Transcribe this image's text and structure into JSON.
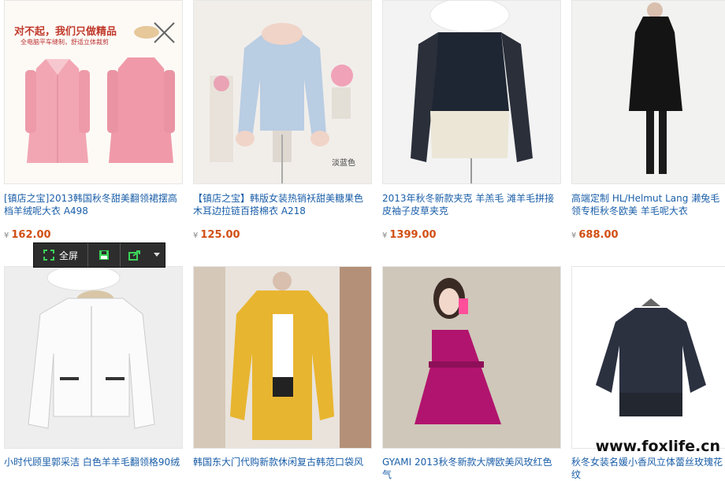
{
  "products": [
    {
      "title": "[镇店之宝]2013韩国秋冬甜美翻领裙摆高档羊绒呢大衣 A498",
      "price": "162.00",
      "currency": "¥",
      "ad_headline": "对不起，我们只做精品",
      "ad_subline": "全电脑平车缝制，舒适立体裁剪"
    },
    {
      "title": "【镇店之宝】韩版女装热销袄甜美糖果色木耳边拉链百搭棉衣 A218",
      "price": "125.00",
      "currency": "¥",
      "color_tag": "淡蓝色"
    },
    {
      "title": "2013年秋冬新款夹克 羊羔毛 滩羊毛拼接皮袖子皮草夹克",
      "price": "1399.00",
      "currency": "¥"
    },
    {
      "title": "高端定制 HL/Helmut Lang 濑兔毛领专柜秋冬欧美 羊毛呢大衣",
      "price": "688.00",
      "currency": "¥"
    },
    {
      "title": "小时代顾里郭采洁 白色羊羊毛翻领格90绒"
    },
    {
      "title": "韩国东大门代购新款休闲复古韩范口袋风"
    },
    {
      "title": "GYAMI 2013秋冬新款大牌欧美风玫红色气"
    },
    {
      "title": "秋冬女装名媛小香风立体蕾丝玫瑰花纹"
    }
  ],
  "toolbar": {
    "fullscreen_label": "全屏",
    "icons": [
      "fullscreen-icon",
      "save-icon",
      "share-icon",
      "dropdown-arrow-icon"
    ]
  },
  "watermark": "www.foxlife.cn"
}
